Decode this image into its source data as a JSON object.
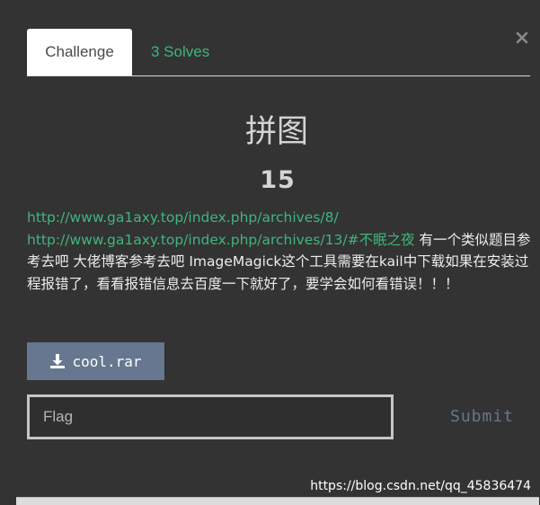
{
  "tabs": {
    "challenge": "Challenge",
    "solves": "3 Solves"
  },
  "challenge": {
    "title": "拼图",
    "points": "15",
    "links": [
      "http://www.ga1axy.top/index.php/archives/8/",
      "http://www.ga1axy.top/index.php/archives/13/#不眠之夜"
    ],
    "description": " 有一个类似题目参考去吧 大佬博客参考去吧 ImageMagick这个工具需要在kail中下载如果在安装过程报错了，看看报错信息去百度一下就好了，要学会如何看错误！！！"
  },
  "download": {
    "label": "cool.rar"
  },
  "flag": {
    "placeholder": "Flag",
    "value": ""
  },
  "submit": {
    "label": "Submit"
  },
  "watermark": "https://blog.csdn.net/qq_45836474",
  "colors": {
    "background": "#333333",
    "accent_green": "#3fb57e",
    "download_button": "#66778f",
    "submit_text": "#68768a"
  },
  "icons": {
    "close": "close-icon",
    "download": "download-icon"
  }
}
